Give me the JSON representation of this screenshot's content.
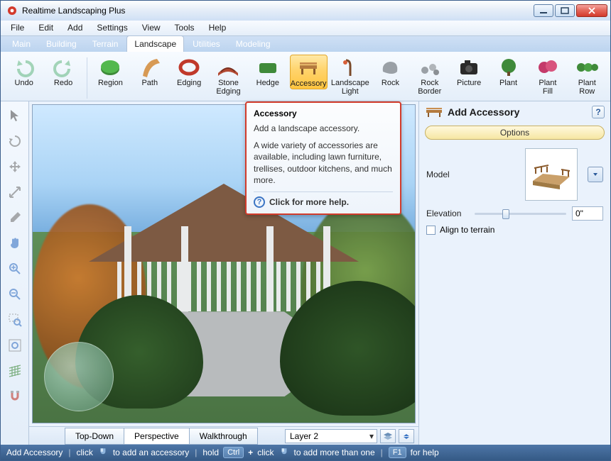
{
  "window": {
    "title": "Realtime Landscaping Plus"
  },
  "menubar": [
    "File",
    "Edit",
    "Add",
    "Settings",
    "View",
    "Tools",
    "Help"
  ],
  "tabs": {
    "items": [
      "Main",
      "Building",
      "Terrain",
      "Landscape",
      "Utilities",
      "Modeling"
    ],
    "active": "Landscape"
  },
  "ribbon": [
    {
      "id": "undo",
      "label": "Undo"
    },
    {
      "id": "redo",
      "label": "Redo"
    },
    {
      "sep": true
    },
    {
      "id": "region",
      "label": "Region"
    },
    {
      "id": "path",
      "label": "Path"
    },
    {
      "id": "edging",
      "label": "Edging"
    },
    {
      "id": "stone-edging",
      "label": "Stone\nEdging"
    },
    {
      "id": "hedge",
      "label": "Hedge"
    },
    {
      "id": "accessory",
      "label": "Accessory",
      "active": true
    },
    {
      "id": "landscape-light",
      "label": "Landscape\nLight"
    },
    {
      "id": "rock",
      "label": "Rock"
    },
    {
      "id": "rock-border",
      "label": "Rock\nBorder"
    },
    {
      "id": "picture",
      "label": "Picture"
    },
    {
      "id": "plant",
      "label": "Plant"
    },
    {
      "id": "plant-fill",
      "label": "Plant\nFill"
    },
    {
      "id": "plant-row",
      "label": "Plant\nRow"
    }
  ],
  "tooltip": {
    "title": "Accessory",
    "line1": "Add a landscape accessory.",
    "line2": "A wide variety of accessories are available, including lawn furniture, trellises, outdoor kitchens, and much more.",
    "help": "Click for more help."
  },
  "view_tabs": {
    "items": [
      "Top-Down",
      "Perspective",
      "Walkthrough"
    ],
    "active": "Perspective"
  },
  "layer": {
    "selected": "Layer 2"
  },
  "panel": {
    "title": "Add Accessory",
    "section": "Options",
    "model_label": "Model",
    "elevation_label": "Elevation",
    "elevation_value": "0\"",
    "align_label": "Align to terrain"
  },
  "statusbar": {
    "mode": "Add Accessory",
    "hint1a": "click",
    "hint1b": "to add an accessory",
    "hint2a": "hold",
    "hint2b": "Ctrl",
    "hint2c": "click",
    "hint2d": "to add more than one",
    "hint3a": "F1",
    "hint3b": "for help"
  }
}
